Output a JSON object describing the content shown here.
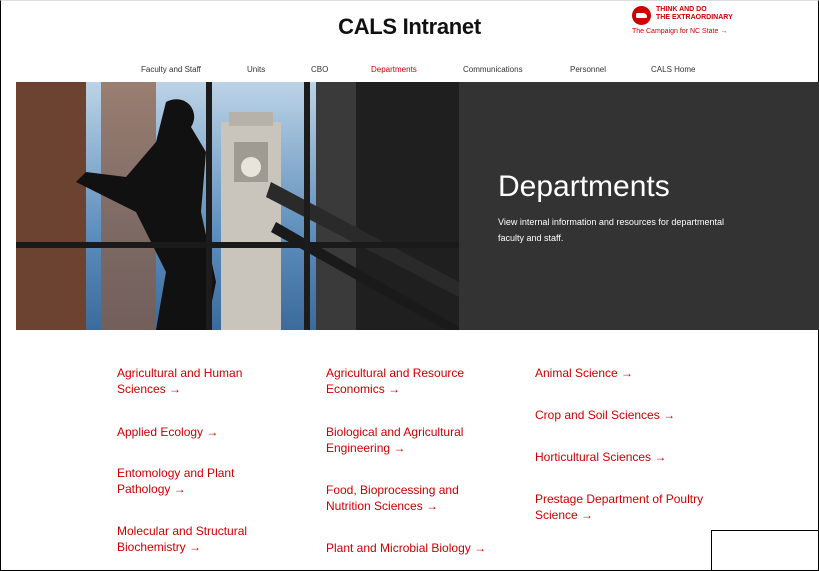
{
  "header": {
    "site_title": "CALS Intranet",
    "campaign_line1": "THINK AND DO",
    "campaign_line2": "THE EXTRAORDINARY",
    "campaign_link": "The Campaign for NC State →"
  },
  "nav": {
    "items": [
      {
        "label": "Faculty and Staff"
      },
      {
        "label": "Units"
      },
      {
        "label": "CBO"
      },
      {
        "label": "Departments"
      },
      {
        "label": "Communications"
      },
      {
        "label": "Personnel"
      },
      {
        "label": "CALS Home"
      }
    ],
    "active": "Departments",
    "accent_color": "#cc0000"
  },
  "hero": {
    "title": "Departments",
    "description": "View internal information and resources for departmental faculty and staff."
  },
  "departments": [
    {
      "label": "Agricultural and Human Sciences →"
    },
    {
      "label": "Applied Ecology →"
    },
    {
      "label": "Entomology and Plant Pathology →"
    },
    {
      "label": "Molecular and Structural Biochemistry →"
    },
    {
      "label": "Agricultural and Resource Economics →"
    },
    {
      "label": "Biological and Agricultural Engineering →"
    },
    {
      "label": "Food, Bioprocessing and Nutrition Sciences →"
    },
    {
      "label": "Plant and Microbial Biology →"
    },
    {
      "label": "Animal Science →"
    },
    {
      "label": "Crop and Soil Sciences →"
    },
    {
      "label": "Horticultural Sciences →"
    },
    {
      "label": "Prestage Department of Poultry Science →"
    }
  ]
}
